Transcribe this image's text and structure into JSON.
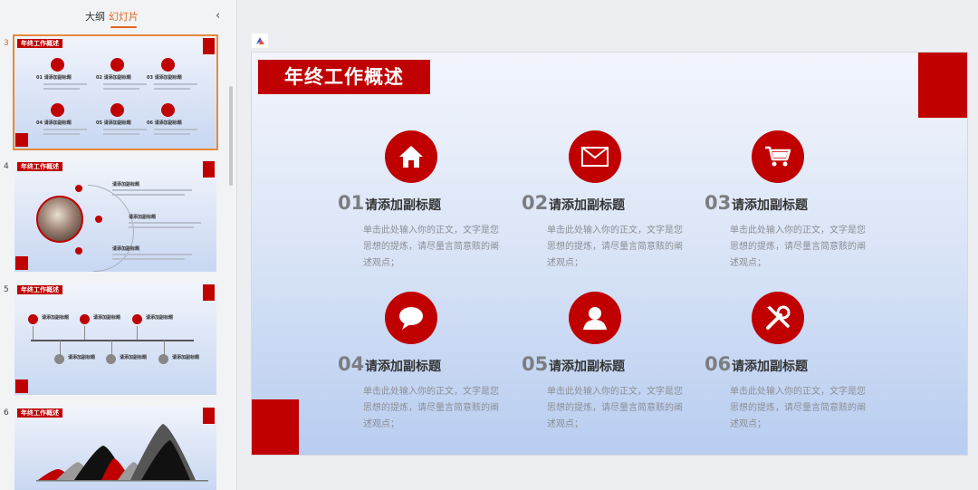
{
  "panel": {
    "tabs": [
      {
        "label": "大纲",
        "active": false
      },
      {
        "label": "幻灯片",
        "active": true
      }
    ],
    "collapse_icon": "chevron-left-icon",
    "thumbnails": [
      {
        "number": "3",
        "title": "年终工作概述",
        "active": true,
        "items": [
          {
            "num": "01",
            "heading": "请添加副标题",
            "icon": "home-icon"
          },
          {
            "num": "02",
            "heading": "请添加副标题",
            "icon": "mail-icon"
          },
          {
            "num": "03",
            "heading": "请添加副标题",
            "icon": "cart-icon"
          },
          {
            "num": "04",
            "heading": "请添加副标题",
            "icon": "chat-icon"
          },
          {
            "num": "05",
            "heading": "请添加副标题",
            "icon": "user-icon"
          },
          {
            "num": "06",
            "heading": "请添加副标题",
            "icon": "tools-icon"
          }
        ]
      },
      {
        "number": "4",
        "title": "年终工作概述",
        "active": false,
        "headings": [
          "请添加副标题",
          "请添加副标题",
          "请添加副标题"
        ]
      },
      {
        "number": "5",
        "title": "年终工作概述",
        "active": false,
        "headings": [
          "请添加副标题",
          "请添加副标题",
          "请添加副标题",
          "请添加副标题",
          "请添加副标题",
          "请添加副标题"
        ]
      },
      {
        "number": "6",
        "title": "年终工作概述",
        "active": false
      }
    ]
  },
  "slide": {
    "title": "年终工作概述",
    "items": [
      {
        "num": "01",
        "subtitle": "请添加副标题",
        "body": "单击此处输入你的正文，文字是您思想的提炼，请尽量言简意赅的阐述观点；",
        "icon": "home-icon"
      },
      {
        "num": "02",
        "subtitle": "请添加副标题",
        "body": "单击此处输入你的正文，文字是您思想的提炼，请尽量言简意赅的阐述观点；",
        "icon": "mail-icon"
      },
      {
        "num": "03",
        "subtitle": "请添加副标题",
        "body": "单击此处输入你的正文，文字是您思想的提炼，请尽量言简意赅的阐述观点；",
        "icon": "cart-icon"
      },
      {
        "num": "04",
        "subtitle": "请添加副标题",
        "body": "单击此处输入你的正文，文字是您思想的提炼，请尽量言简意赅的阐述观点；",
        "icon": "chat-icon"
      },
      {
        "num": "05",
        "subtitle": "请添加副标题",
        "body": "单击此处输入你的正文，文字是您思想的提炼，请尽量言简意赅的阐述观点；",
        "icon": "user-icon"
      },
      {
        "num": "06",
        "subtitle": "请添加副标题",
        "body": "单击此处输入你的正文，文字是您思想的提炼，请尽量言简意赅的阐述观点；",
        "icon": "tools-icon"
      }
    ]
  },
  "colors": {
    "accent": "#c00000",
    "tab_active": "#e0651b",
    "selection_border": "#e58a3b"
  }
}
